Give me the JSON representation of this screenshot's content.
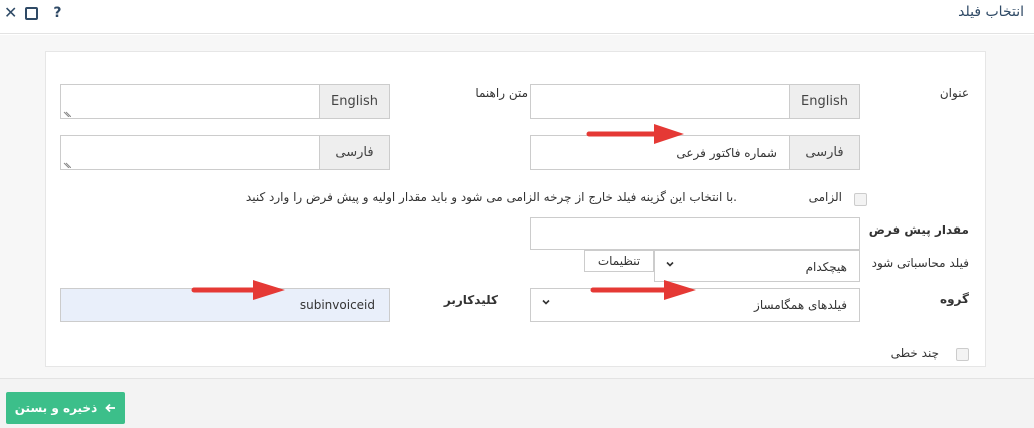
{
  "window": {
    "title": "انتخاب فیلد",
    "help_label": "?"
  },
  "form": {
    "title_label": "عنوان",
    "title_en_addon": "English",
    "title_fa_addon": "فارسی",
    "title_fa_value": "شماره فاکتور فرعی",
    "hint_label": "متن راهنما",
    "hint_en_addon": "English",
    "hint_fa_addon": "فارسی",
    "required_label": "الزامی",
    "required_hint": "با انتخاب این گزینه فیلد خارج از چرخه الزامی می شود و باید مقدار اولیه و پیش فرض را وارد کنید.",
    "default_label": "مقدار پیش فرض",
    "calc_label": "فیلد محاسباتی شود",
    "calc_value": "هیچکدام",
    "settings_label": "تنظیمات",
    "group_label": "گروه",
    "group_value": "فیلدهای همگامساز",
    "keyword_label": "کلیدکاربر",
    "keyword_value": "subinvoiceid",
    "multiline_label": "چند خطی"
  },
  "footer": {
    "save_label": "ذخیره و بستن"
  },
  "colors": {
    "accent": "#3cbf8a",
    "arrow": "#e53935",
    "title": "#2f4a66"
  }
}
